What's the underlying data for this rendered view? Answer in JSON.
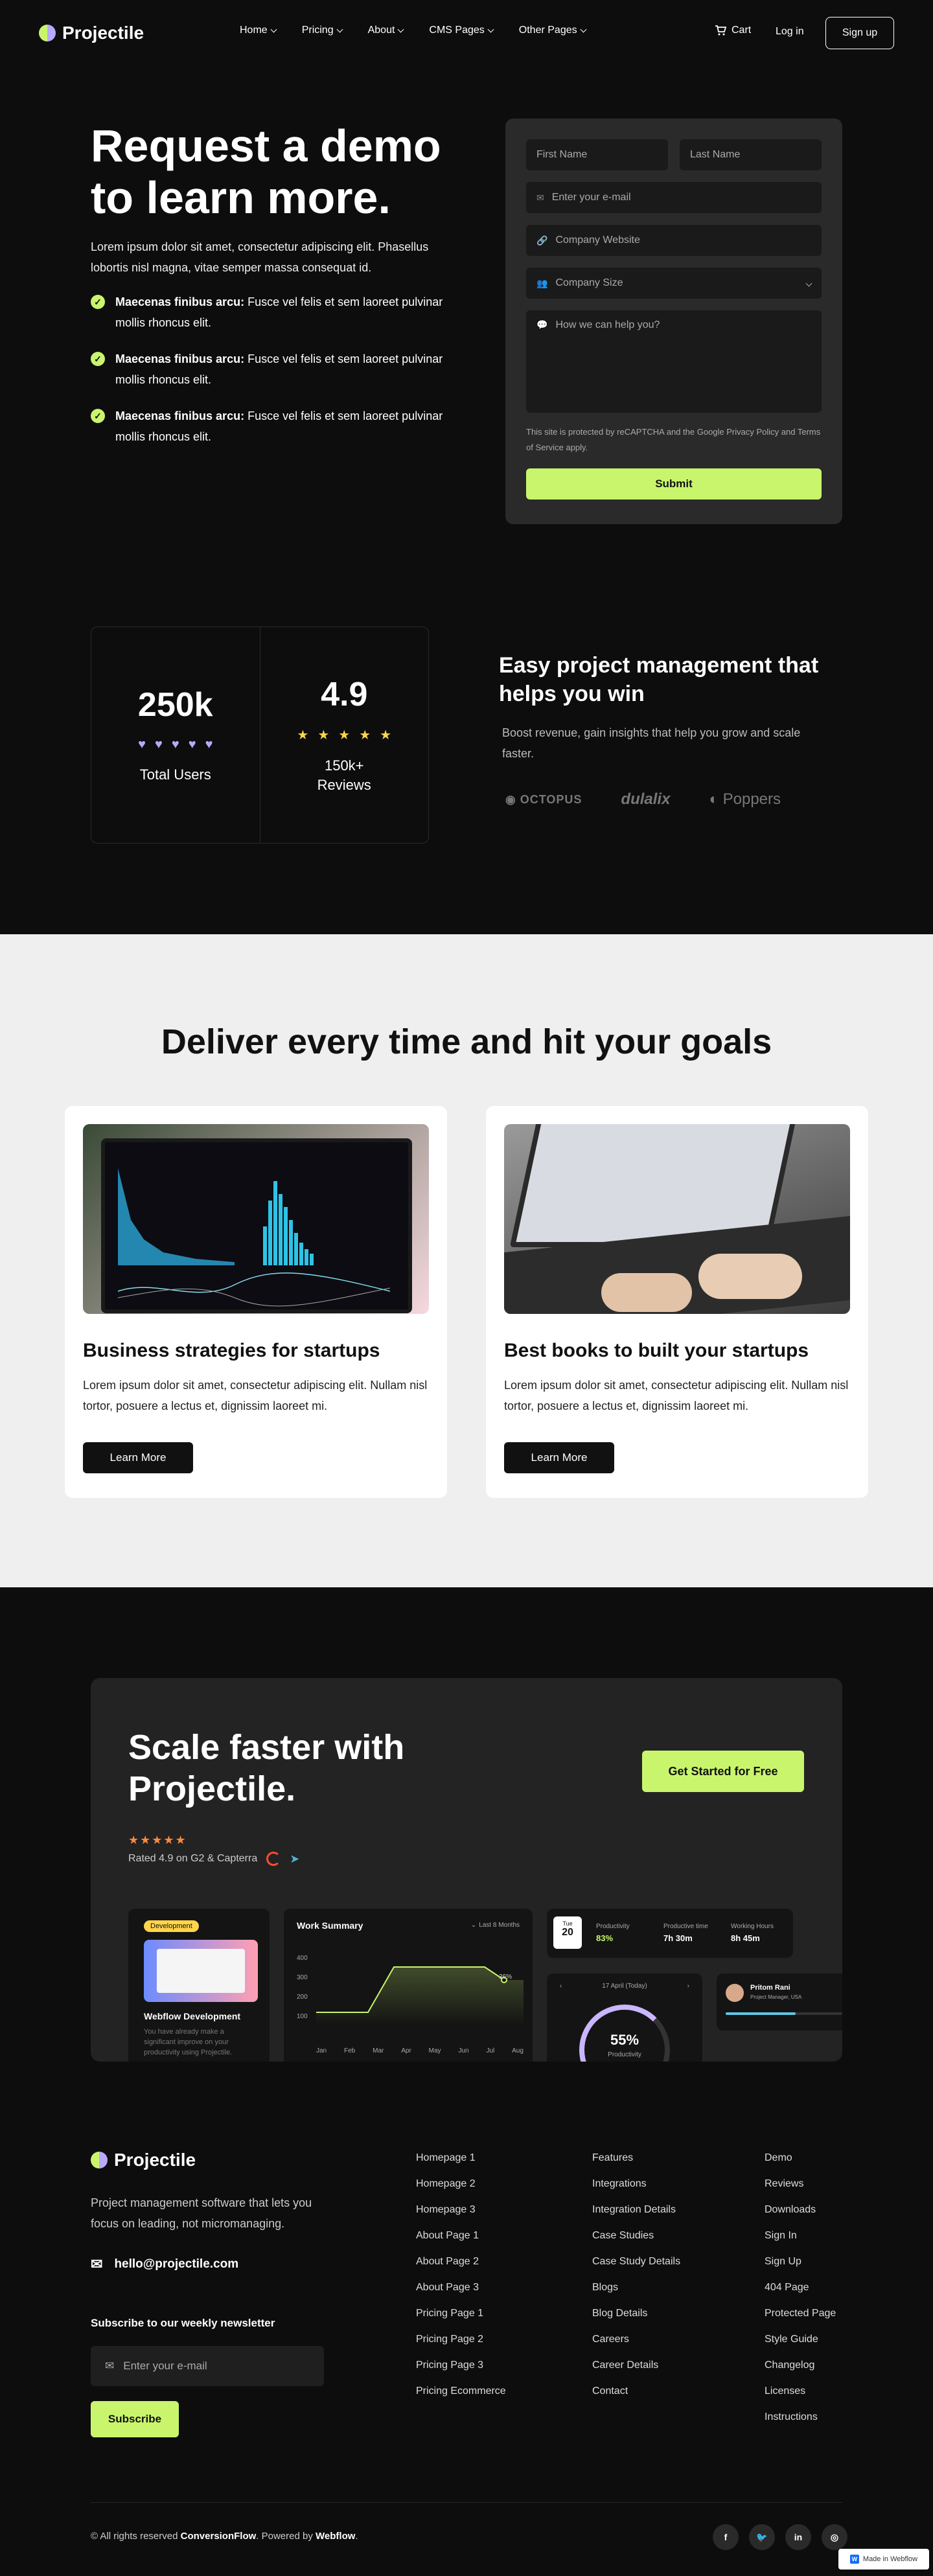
{
  "brand": {
    "name": "Projectile"
  },
  "nav": {
    "items": [
      {
        "label": "Home"
      },
      {
        "label": "Pricing"
      },
      {
        "label": "About"
      },
      {
        "label": "CMS Pages"
      },
      {
        "label": "Other Pages"
      }
    ],
    "cart": "Cart",
    "login": "Log in",
    "signup": "Sign up"
  },
  "hero": {
    "title": "Request a demo to learn more.",
    "desc": "Lorem ipsum dolor sit amet, consectetur adipiscing elit. Phasellus lobortis nisl magna, vitae semper massa consequat id.",
    "checks": [
      {
        "bold": "Maecenas finibus arcu:",
        "text": " Fusce vel felis et sem laoreet pulvinar mollis rhoncus elit."
      },
      {
        "bold": "Maecenas finibus arcu:",
        "text": " Fusce vel felis et sem laoreet pulvinar mollis rhoncus elit."
      },
      {
        "bold": "Maecenas finibus arcu:",
        "text": " Fusce vel felis et sem laoreet pulvinar mollis rhoncus elit."
      }
    ]
  },
  "form": {
    "first_name": "First Name",
    "last_name": "Last Name",
    "email": "Enter your e-mail",
    "website": "Company Website",
    "size": "Company Size",
    "message": "How we can help you?",
    "notice": "This site is protected by reCAPTCHA and the Google Privacy Policy and Terms of Service apply.",
    "submit": "Submit"
  },
  "stats": {
    "users_num": "250k",
    "users_label": "Total Users",
    "reviews_num": "4.9",
    "reviews_label": "150k+ Reviews",
    "stars": 5
  },
  "pm": {
    "title": "Easy project management that helps you win",
    "desc": "Boost revenue, gain insights that help you grow and scale faster.",
    "brands": [
      "OCTOPUS",
      "dulalix",
      "Poppers"
    ]
  },
  "deliver": {
    "title": "Deliver every time and hit your goals",
    "cards": [
      {
        "title": "Business strategies for startups",
        "desc": "Lorem ipsum dolor sit amet, consectetur adipiscing elit. Nullam nisl tortor, posuere a lectus et, dignissim laoreet mi.",
        "button": "Learn More"
      },
      {
        "title": "Best books to built your startups",
        "desc": "Lorem ipsum dolor sit amet, consectetur adipiscing elit. Nullam nisl tortor, posuere a lectus et, dignissim laoreet mi.",
        "button": "Learn More"
      }
    ]
  },
  "cta": {
    "title": "Scale faster with Projectile.",
    "button": "Get Started for Free",
    "rated": "Rated 4.9 on G2 & Capterra",
    "mock": {
      "badge": "Development",
      "card_title": "Webflow Development",
      "card_text": "You have already make a significant improve on your productivity using Projectile.",
      "ws_title": "Work Summary",
      "ws_range": "Last 8 Months",
      "ws_months": [
        "Jan",
        "Feb",
        "Mar",
        "Apr",
        "May",
        "Jun",
        "Jul",
        "Aug"
      ],
      "ws_y": [
        "400",
        "300",
        "200",
        "100"
      ],
      "ws_pct": "36%",
      "tue": "Tue",
      "day": "20",
      "productivity": "Productivity",
      "prod_val": "83%",
      "ptime": "Productive time",
      "ptime_val": "7h 30m",
      "whours": "Working Hours",
      "whours_val": "8h 45m",
      "date": "17 April (Today)",
      "pct": "55%",
      "pct_label": "Productivity",
      "person": "Pritom Rani",
      "role": "Project Manager, USA"
    }
  },
  "footer": {
    "desc": "Project management software that lets you focus on leading, not micromanaging.",
    "email": "hello@projectile.com",
    "newsletter": "Subscribe to our weekly newsletter",
    "input": "Enter your e-mail",
    "subscribe": "Subscribe",
    "col1": [
      "Homepage 1",
      "Homepage 2",
      "Homepage 3",
      "About Page 1",
      "About Page 2",
      "About Page 3",
      "Pricing Page 1",
      "Pricing Page 2",
      "Pricing Page 3",
      "Pricing Ecommerce"
    ],
    "col2": [
      "Features",
      "Integrations",
      "Integration Details",
      "Case Studies",
      "Case Study Details",
      "Blogs",
      "Blog Details",
      "Careers",
      "Career Details",
      "Contact"
    ],
    "col3": [
      "Demo",
      "Reviews",
      "Downloads",
      "Sign In",
      "Sign Up",
      "404 Page",
      "Protected Page",
      "Style Guide",
      "Changelog",
      "Licenses",
      "Instructions"
    ],
    "copy_pre": "© All rights reserved ",
    "copy_brand": "ConversionFlow",
    "copy_mid": ". Powered by ",
    "copy_wf": "Webflow",
    "copy_end": ".",
    "socials": [
      "f",
      "t",
      "in",
      "ig"
    ],
    "made_in": "Made in Webflow"
  },
  "colors": {
    "accent": "#c9f56d",
    "purple": "#b8a9ff",
    "dark": "#0d0d0d",
    "star": "#ff8a3d"
  }
}
